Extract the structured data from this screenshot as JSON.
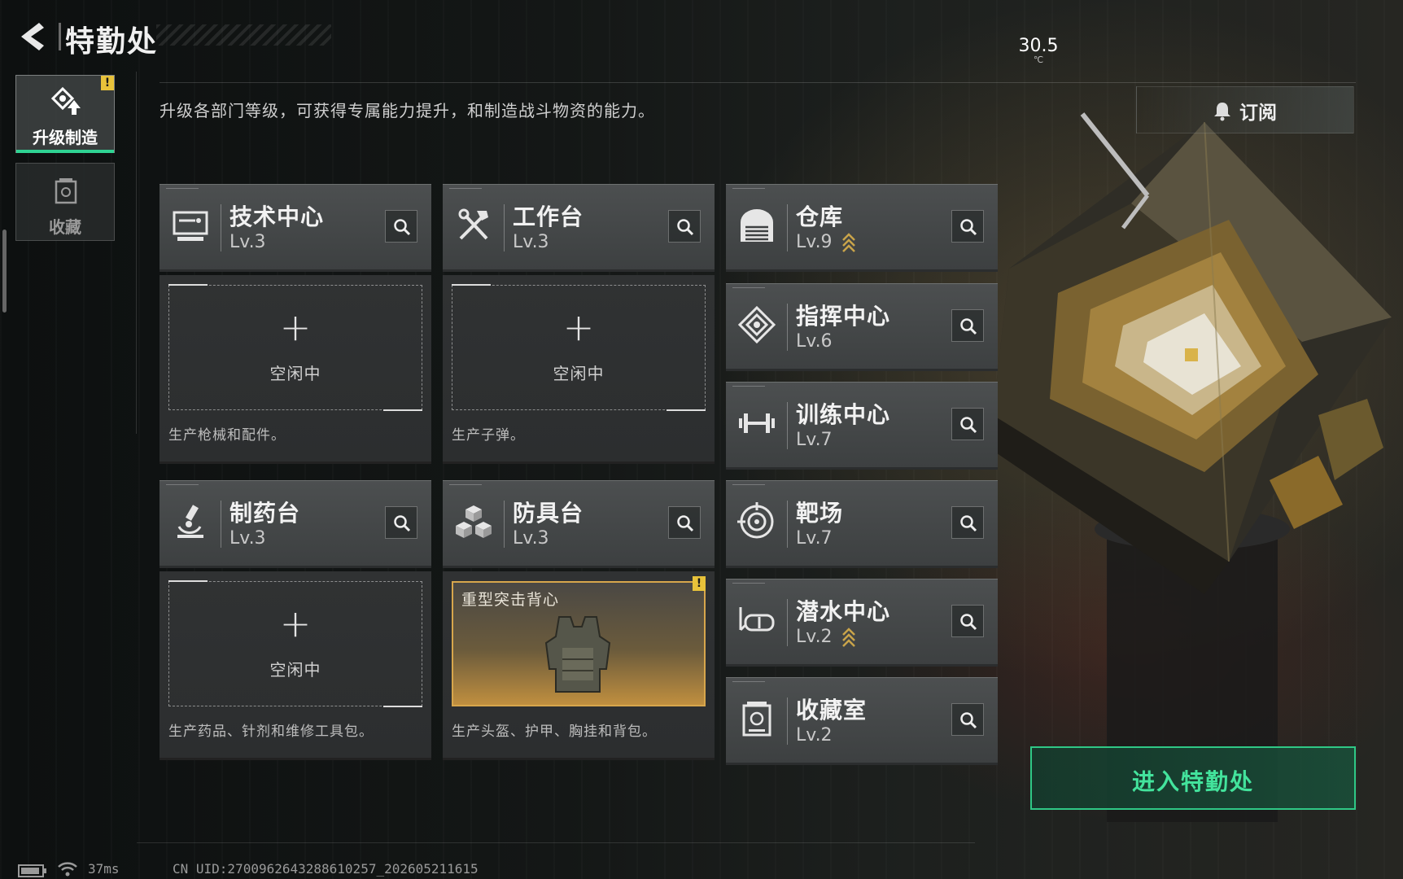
{
  "header": {
    "title": "特勤处",
    "temperature": "30.5",
    "temperature_unit": "℃"
  },
  "sidebar": {
    "items": [
      {
        "label": "升级制造",
        "icon": "upgrade-icon",
        "active": true,
        "badge": "!"
      },
      {
        "label": "收藏",
        "icon": "collection-icon",
        "active": false
      }
    ]
  },
  "description": "升级各部门等级，可获得专属能力提升，和制造战斗物资的能力。",
  "subscribe_label": "订阅",
  "departments": {
    "tech_center": {
      "name": "技术中心",
      "level": "Lv.3",
      "icon": "monitor-icon"
    },
    "workbench": {
      "name": "工作台",
      "level": "Lv.3",
      "icon": "tools-icon"
    },
    "pharmacy": {
      "name": "制药台",
      "level": "Lv.3",
      "icon": "microscope-icon"
    },
    "armor": {
      "name": "防具台",
      "level": "Lv.3",
      "icon": "blocks-icon"
    },
    "warehouse": {
      "name": "仓库",
      "level": "Lv.9",
      "icon": "warehouse-icon",
      "upgradable": true
    },
    "command": {
      "name": "指挥中心",
      "level": "Lv.6",
      "icon": "command-icon"
    },
    "training": {
      "name": "训练中心",
      "level": "Lv.7",
      "icon": "dumbbell-icon"
    },
    "range": {
      "name": "靶场",
      "level": "Lv.7",
      "icon": "target-icon"
    },
    "diving": {
      "name": "潜水中心",
      "level": "Lv.2",
      "icon": "goggles-icon",
      "upgradable": true
    },
    "collection_room": {
      "name": "收藏室",
      "level": "Lv.2",
      "icon": "collection-icon"
    }
  },
  "production": {
    "tech_center": {
      "status": "空闲中",
      "plus": "+",
      "desc": "生产枪械和配件。"
    },
    "workbench": {
      "status": "空闲中",
      "plus": "+",
      "desc": "生产子弹。"
    },
    "pharmacy": {
      "status": "空闲中",
      "plus": "+",
      "desc": "生产药品、针剂和维修工具包。"
    },
    "armor": {
      "item_name": "重型突击背心",
      "badge": "!",
      "desc": "生产头盔、护甲、胸挂和背包。"
    }
  },
  "enter_button": "进入特勤处",
  "status_bar": {
    "ping": "37ms",
    "uid": "CN UID:2700962643288610257_202605211615"
  },
  "colors": {
    "accent_green": "#2fc886",
    "badge_yellow": "#e8c23a",
    "item_gold": "#d7a64c"
  }
}
